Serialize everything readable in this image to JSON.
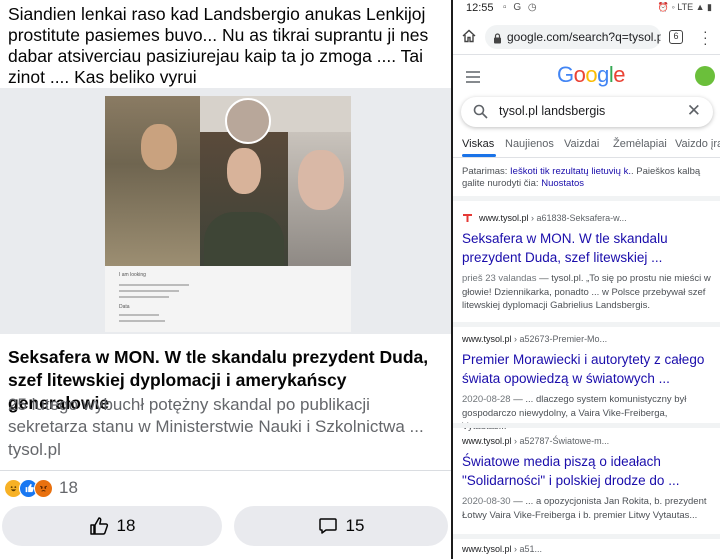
{
  "facebook": {
    "post_text": "Siandien lenkai raso kad Landsbergio anukas Lenkijoj prostitute pasiemes buvo... Nu as tikrai suprantu ji nes dabar atsiverciau pasiziurejau kaip ta jo zmoga .... Tai zinot .... Kas beliko vyrui",
    "image_doc_line1": "I am looking",
    "image_doc_line2": "Data",
    "link_title": "Seksafera w MON. W tle skandalu prezydent Duda, szef litewskiej dyplomacji i amerykańscy generałowie",
    "link_desc": "25 lutego wybuchł potężny skandal po publikacji sekretarza stanu w Ministerstwie Nauki i Szkolnictwa ...",
    "link_source": "tysol.pl",
    "reaction_count": "18",
    "like_button_count": "18",
    "comment_button_count": "15"
  },
  "status_bar": {
    "time": "12:55",
    "network": "LTE"
  },
  "browser": {
    "url": "google.com/search?q=tysol.pl+",
    "tab_count": "6"
  },
  "google": {
    "logo_letters": [
      "G",
      "o",
      "o",
      "g",
      "l",
      "e"
    ],
    "query": "tysol.pl landsbergis",
    "tabs": [
      "Viskas",
      "Naujienos",
      "Vaizdai",
      "Žemėlapiai",
      "Vaizdo įrašai"
    ],
    "tip_prefix": "Patarimas:",
    "tip_link1": "Ieškoti tik rezultatų lietuvių k.",
    "tip_middle": ". Paieškos kalbą galite nurodyti čia:",
    "tip_link2": "Nuostatos",
    "results": [
      {
        "site": "www.tysol.pl",
        "path": "› a61838-Seksafera-w...",
        "title": "Seksafera w MON. W tle skandalu prezydent Duda, szef litewskiej ...",
        "date": "prieš 23 valandas",
        "snippet": " — tysol.pl. „To się po prostu nie mieści w głowie! Dziennikarka, ponadto ... w Polsce przebywał szef litewskiej dyplomacji Gabrielius Landsbergis."
      },
      {
        "site": "www.tysol.pl",
        "path": "› a52673-Premier-Mo...",
        "title": "Premier Morawiecki i autorytety z całego świata opowiedzą w światowych ...",
        "date": "2020-08-28",
        "snippet": " — ... dlaczego system komunistyczny był gospodarczo niewydolny, a Vaira Vike-Freiberga, Vytautas..."
      },
      {
        "site": "www.tysol.pl",
        "path": "› a52787-Światowe-m...",
        "title": "Światowe media piszą o ideałach \"Solidarności\" i polskiej drodze do ...",
        "date": "2020-08-30",
        "snippet": " — ... a opozycjonista Jan Rokita, b. prezydent Łotwy Vaira Vike-Freiberga i b. premier Litwy Vytautas..."
      },
      {
        "site": "www.tysol.pl",
        "path": "› a51...",
        "title": "",
        "date": "",
        "snippet": ""
      }
    ]
  }
}
